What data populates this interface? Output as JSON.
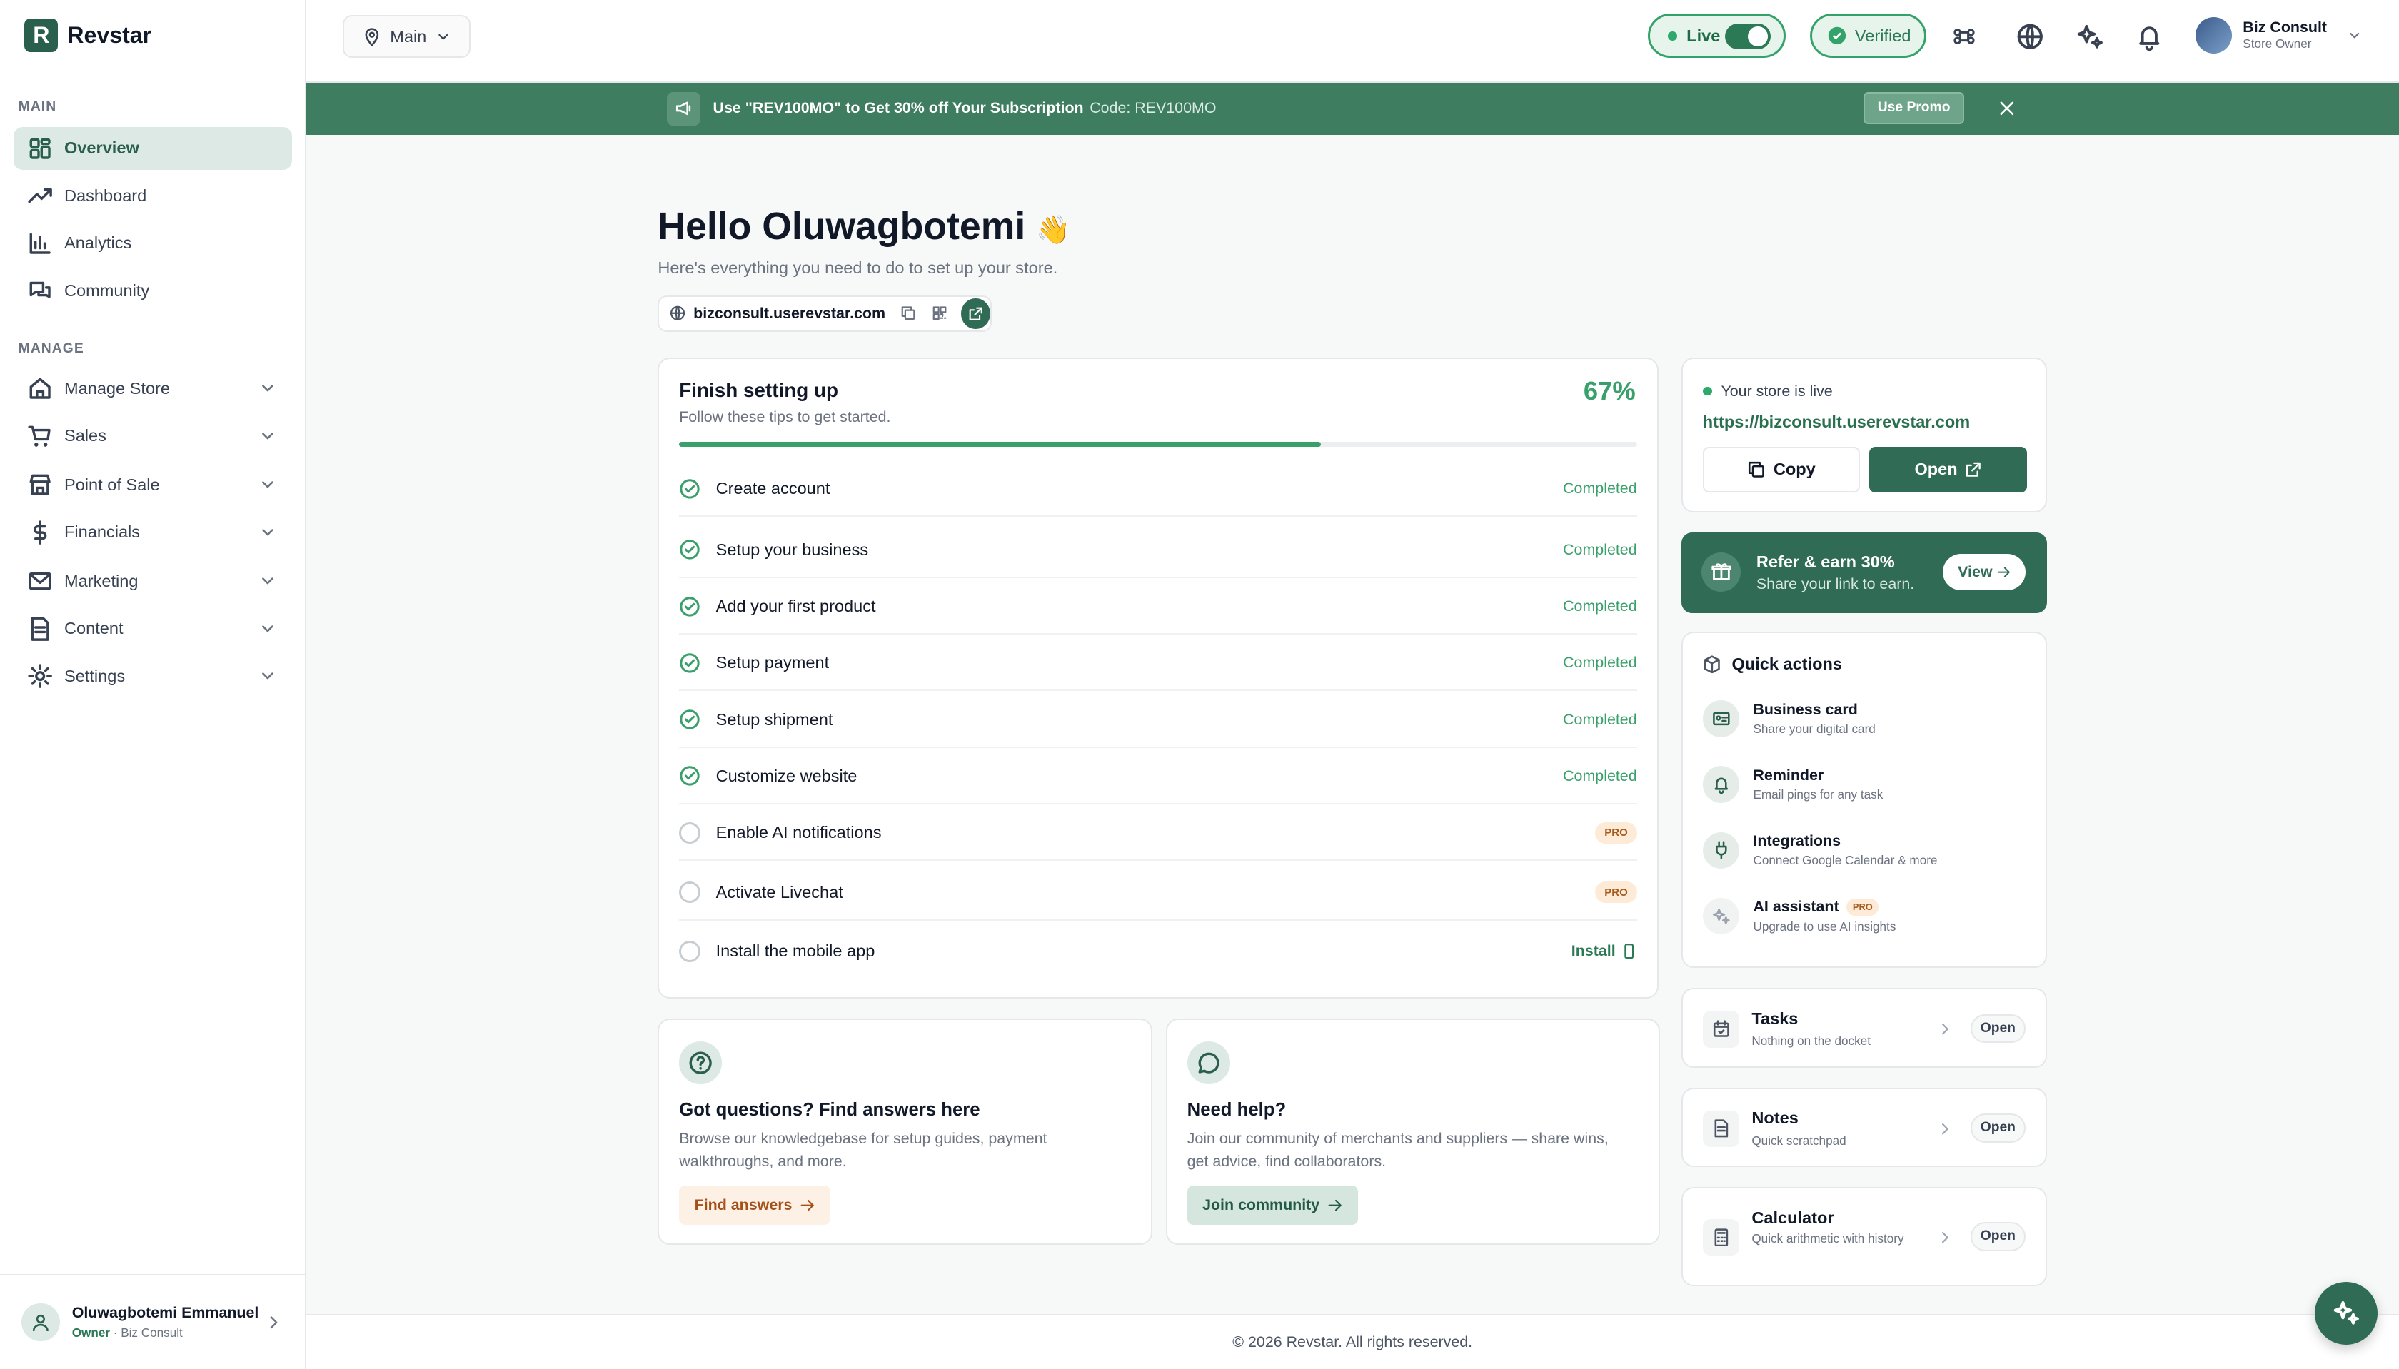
{
  "brand": {
    "name": "Revstar",
    "logo_letter": "R"
  },
  "sidebar": {
    "main_label": "MAIN",
    "manage_label": "MANAGE",
    "main_items": [
      {
        "label": "Overview",
        "icon": "grid-icon",
        "active": true
      },
      {
        "label": "Dashboard",
        "icon": "trend-icon"
      },
      {
        "label": "Analytics",
        "icon": "bar-chart-icon"
      },
      {
        "label": "Community",
        "icon": "chat-icon"
      }
    ],
    "manage_items": [
      {
        "label": "Manage Store",
        "icon": "home-icon"
      },
      {
        "label": "Sales",
        "icon": "cart-icon"
      },
      {
        "label": "Point of Sale",
        "icon": "store-icon"
      },
      {
        "label": "Financials",
        "icon": "dollar-icon"
      },
      {
        "label": "Marketing",
        "icon": "mail-icon"
      },
      {
        "label": "Content",
        "icon": "file-icon"
      },
      {
        "label": "Settings",
        "icon": "gear-icon"
      }
    ],
    "user": {
      "name": "Oluwagbotemi Emmanuel",
      "role": "Owner",
      "org": "Biz Consult"
    }
  },
  "header": {
    "location": "Main",
    "live_label": "Live",
    "verified_label": "Verified",
    "user": {
      "name": "Biz Consult",
      "role": "Store Owner"
    }
  },
  "promo": {
    "text": "Use \"REV100MO\" to Get 30% off Your Subscription",
    "code": "Code: REV100MO",
    "button": "Use Promo"
  },
  "main": {
    "greeting": "Hello Oluwagbotemi",
    "wave": "👋",
    "subtitle": "Here's everything you need to do to set up your store.",
    "domain": "bizconsult.userevstar.com"
  },
  "setup": {
    "title": "Finish setting up",
    "tip": "Follow these tips to get started.",
    "percent_label": "67%",
    "progress": 0.67,
    "tasks": [
      {
        "label": "Create account",
        "status": "Completed",
        "done": true
      },
      {
        "label": "Setup your business",
        "status": "Completed",
        "done": true
      },
      {
        "label": "Add your first product",
        "status": "Completed",
        "done": true
      },
      {
        "label": "Setup payment",
        "status": "Completed",
        "done": true
      },
      {
        "label": "Setup shipment",
        "status": "Completed",
        "done": true
      },
      {
        "label": "Customize website",
        "status": "Completed",
        "done": true
      },
      {
        "label": "Enable AI notifications",
        "status": "PRO",
        "done": false
      },
      {
        "label": "Activate Livechat",
        "status": "PRO",
        "done": false
      },
      {
        "label": "Install the mobile app",
        "status": "Install",
        "done": false
      }
    ]
  },
  "help_cards": [
    {
      "title": "Got questions? Find answers here",
      "text": "Browse our knowledgebase for setup guides, payment walkthroughs, and more.",
      "button": "Find answers"
    },
    {
      "title": "Need help?",
      "text": "Join our community of merchants and suppliers — share wins, get advice, find collaborators.",
      "button": "Join community"
    }
  ],
  "store_live": {
    "label": "Your store is live",
    "url": "https://bizconsult.userevstar.com",
    "copy": "Copy",
    "open": "Open"
  },
  "refer": {
    "title": "Refer & earn 30%",
    "subtitle": "Share your link to earn.",
    "button": "View"
  },
  "quick_actions": {
    "title": "Quick actions",
    "items": [
      {
        "title": "Business card",
        "subtitle": "Share your digital card"
      },
      {
        "title": "Reminder",
        "subtitle": "Email pings for any task"
      },
      {
        "title": "Integrations",
        "subtitle": "Connect Google Calendar & more"
      },
      {
        "title": "AI assistant",
        "subtitle": "Upgrade to use AI insights",
        "badge": "PRO"
      }
    ]
  },
  "tools": [
    {
      "title": "Tasks",
      "subtitle": "Nothing on the docket",
      "button": "Open"
    },
    {
      "title": "Notes",
      "subtitle": "Quick scratchpad",
      "button": "Open"
    },
    {
      "title": "Calculator",
      "subtitle": "Quick arithmetic with history",
      "button": "Open"
    }
  ],
  "footer": "© 2026 Revstar. All rights reserved.",
  "colors": {
    "brand": "#2f6b55",
    "accent": "#3aa06b",
    "pro_bg": "#fdebd8",
    "pro_text": "#a55a1b"
  }
}
